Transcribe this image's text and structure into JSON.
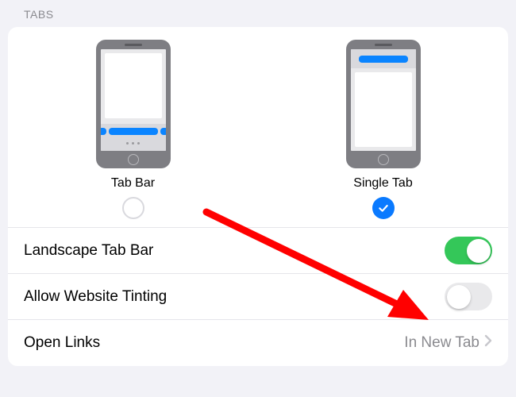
{
  "section_header": "TABS",
  "tab_style": {
    "options": [
      {
        "label": "Tab Bar",
        "selected": false
      },
      {
        "label": "Single Tab",
        "selected": true
      }
    ]
  },
  "rows": {
    "landscape": {
      "label": "Landscape Tab Bar",
      "on": true
    },
    "tinting": {
      "label": "Allow Website Tinting",
      "on": false
    },
    "openlinks": {
      "label": "Open Links",
      "value": "In New Tab"
    }
  },
  "colors": {
    "accent": "#0a7aff",
    "switch_on": "#34c759"
  }
}
